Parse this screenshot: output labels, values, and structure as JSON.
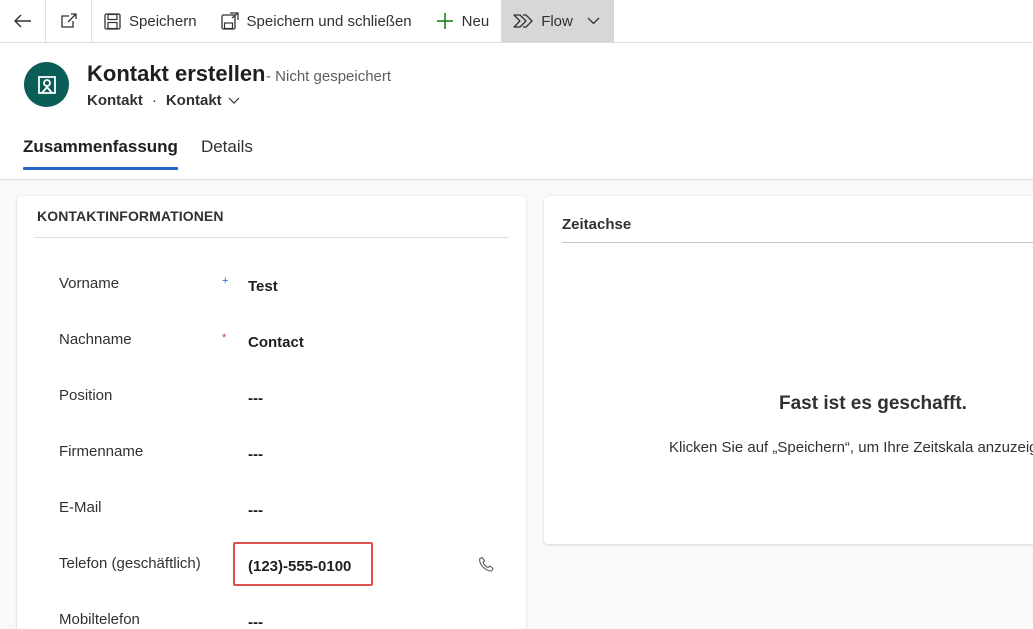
{
  "command_bar": {
    "save_label": "Speichern",
    "save_close_label": "Speichern und schließen",
    "new_label": "Neu",
    "flow_label": "Flow"
  },
  "header": {
    "title": "Kontakt erstellen",
    "status": "- Nicht gespeichert",
    "entity": "Kontakt",
    "separator": "·",
    "form_selector": "Kontakt"
  },
  "tabs": [
    {
      "label": "Zusammenfassung",
      "active": true
    },
    {
      "label": "Details",
      "active": false
    }
  ],
  "contact_section": {
    "title": "KONTAKTINFORMATIONEN",
    "fields": [
      {
        "label": "Vorname",
        "value": "Test",
        "required_marker": "+"
      },
      {
        "label": "Nachname",
        "value": "Contact",
        "required_marker": "*"
      },
      {
        "label": "Position",
        "value": "---"
      },
      {
        "label": "Firmenname",
        "value": "---"
      },
      {
        "label": "E-Mail",
        "value": "---"
      },
      {
        "label": "Telefon (geschäftlich)",
        "value": "(123)-555-0100"
      },
      {
        "label": "Mobiltelefon",
        "value": "---"
      }
    ]
  },
  "timeline": {
    "title": "Zeitachse",
    "heading": "Fast ist es geschafft.",
    "message": "Klicken Sie auf „Speichern“, um Ihre Zeitskala anzuzeigen."
  },
  "colors": {
    "accent": "#2266c9",
    "avatar_bg": "#0b5d57",
    "highlight_border": "#d9534f",
    "required": "#d13438"
  }
}
